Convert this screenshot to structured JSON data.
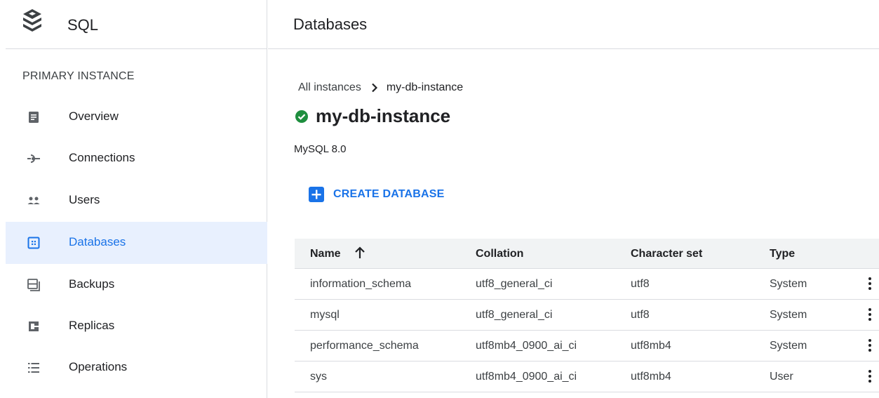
{
  "app": {
    "title": "SQL"
  },
  "sidebar": {
    "section_title": "PRIMARY INSTANCE",
    "items": [
      {
        "label": "Overview",
        "icon": "overview-icon"
      },
      {
        "label": "Connections",
        "icon": "connections-icon"
      },
      {
        "label": "Users",
        "icon": "users-icon"
      },
      {
        "label": "Databases",
        "icon": "databases-icon",
        "active": true
      },
      {
        "label": "Backups",
        "icon": "backups-icon"
      },
      {
        "label": "Replicas",
        "icon": "replicas-icon"
      },
      {
        "label": "Operations",
        "icon": "operations-icon"
      }
    ]
  },
  "header": {
    "title": "Databases"
  },
  "breadcrumb": {
    "root": "All instances",
    "current": "my-db-instance"
  },
  "instance": {
    "name": "my-db-instance",
    "version": "MySQL 8.0",
    "status": "running"
  },
  "actions": {
    "create_label": "CREATE DATABASE"
  },
  "table": {
    "columns": [
      "Name",
      "Collation",
      "Character set",
      "Type"
    ],
    "sort": {
      "column": "Name",
      "direction": "ascending"
    },
    "rows": [
      {
        "name": "information_schema",
        "collation": "utf8_general_ci",
        "charset": "utf8",
        "type": "System"
      },
      {
        "name": "mysql",
        "collation": "utf8_general_ci",
        "charset": "utf8",
        "type": "System"
      },
      {
        "name": "performance_schema",
        "collation": "utf8mb4_0900_ai_ci",
        "charset": "utf8mb4",
        "type": "System"
      },
      {
        "name": "sys",
        "collation": "utf8mb4_0900_ai_ci",
        "charset": "utf8mb4",
        "type": "User"
      }
    ]
  },
  "colors": {
    "accent": "#1a73e8",
    "active_bg": "#e8f0fe",
    "success": "#1e8e3e",
    "border": "#dadce0",
    "header_bg": "#f1f3f4"
  }
}
